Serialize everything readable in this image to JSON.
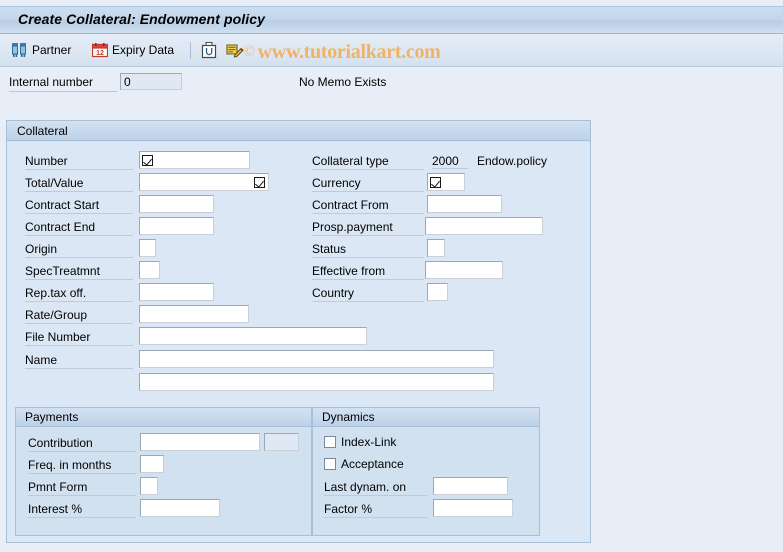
{
  "window": {
    "title": "Create Collateral: Endowment policy"
  },
  "toolbar": {
    "buttons": [
      {
        "label": "Partner",
        "icon": "partner-icon"
      },
      {
        "label": "Expiry Data",
        "icon": "calendar-icon"
      }
    ],
    "icon_buttons": [
      {
        "icon": "clipboard-icon"
      },
      {
        "icon": "note-pencil-icon"
      }
    ]
  },
  "watermark": {
    "copyright": "©",
    "text": "www.tutorialkart.com",
    "color": "#f0b265"
  },
  "header": {
    "internal_number_label": "Internal number",
    "internal_number_value": "0",
    "memo_status": "No Memo Exists"
  },
  "collateral": {
    "title": "Collateral",
    "left_fields": [
      {
        "label": "Number",
        "value": "",
        "icon": "matchcode-icon"
      },
      {
        "label": "Total/Value",
        "value": "",
        "icon": "matchcode-icon"
      },
      {
        "label": "Contract Start",
        "value": ""
      },
      {
        "label": "Contract End",
        "value": ""
      },
      {
        "label": "Origin",
        "value": ""
      },
      {
        "label": "SpecTreatmnt",
        "value": ""
      },
      {
        "label": "Rep.tax off.",
        "value": ""
      },
      {
        "label": "Rate/Group",
        "value": ""
      },
      {
        "label": "File Number",
        "value": ""
      },
      {
        "label": "Name",
        "value": ""
      },
      {
        "label": "",
        "value": ""
      }
    ],
    "right_fields": [
      {
        "label": "Collateral type",
        "value": "2000",
        "description": "Endow.policy"
      },
      {
        "label": "Currency",
        "value": "",
        "icon": "matchcode-icon"
      },
      {
        "label": "Contract From",
        "value": ""
      },
      {
        "label": "Prosp.payment",
        "value": ""
      },
      {
        "label": "Status",
        "value": ""
      },
      {
        "label": "Effective from",
        "value": ""
      },
      {
        "label": "Country",
        "value": ""
      }
    ]
  },
  "payments": {
    "title": "Payments",
    "fields": [
      {
        "label": "Contribution",
        "value": "",
        "currency_value": ""
      },
      {
        "label": "Freq. in months",
        "value": ""
      },
      {
        "label": "Pmnt Form",
        "value": ""
      },
      {
        "label": "Interest %",
        "value": ""
      }
    ]
  },
  "dynamics": {
    "title": "Dynamics",
    "checkboxes": [
      {
        "label": "Index-Link",
        "checked": false
      },
      {
        "label": "Acceptance",
        "checked": false
      }
    ],
    "fields": [
      {
        "label": "Last dynam. on",
        "value": ""
      },
      {
        "label": "Factor %",
        "value": ""
      }
    ]
  }
}
